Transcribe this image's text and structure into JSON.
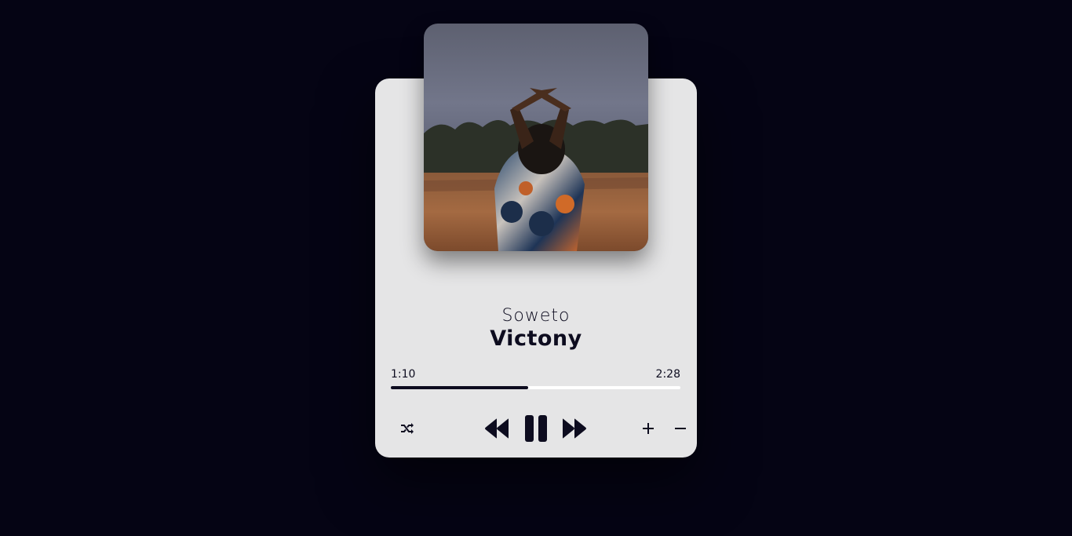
{
  "track": {
    "title": "Soweto",
    "artist": "Victony",
    "cover_icon": "album-cover-image"
  },
  "playback": {
    "current_time": "1:10",
    "total_time": "2:28",
    "progress_fraction": 0.474,
    "state": "playing"
  },
  "controls": {
    "shuffle_icon": "shuffle-icon",
    "previous_icon": "rewind-icon",
    "play_pause_icon": "pause-icon",
    "next_icon": "fast-forward-icon",
    "volume_up_icon": "plus-icon",
    "volume_down_icon": "minus-icon"
  },
  "colors": {
    "background": "#050414",
    "card": "#e5e5e6",
    "accent": "#0d0c1f",
    "track": "#ffffff"
  }
}
